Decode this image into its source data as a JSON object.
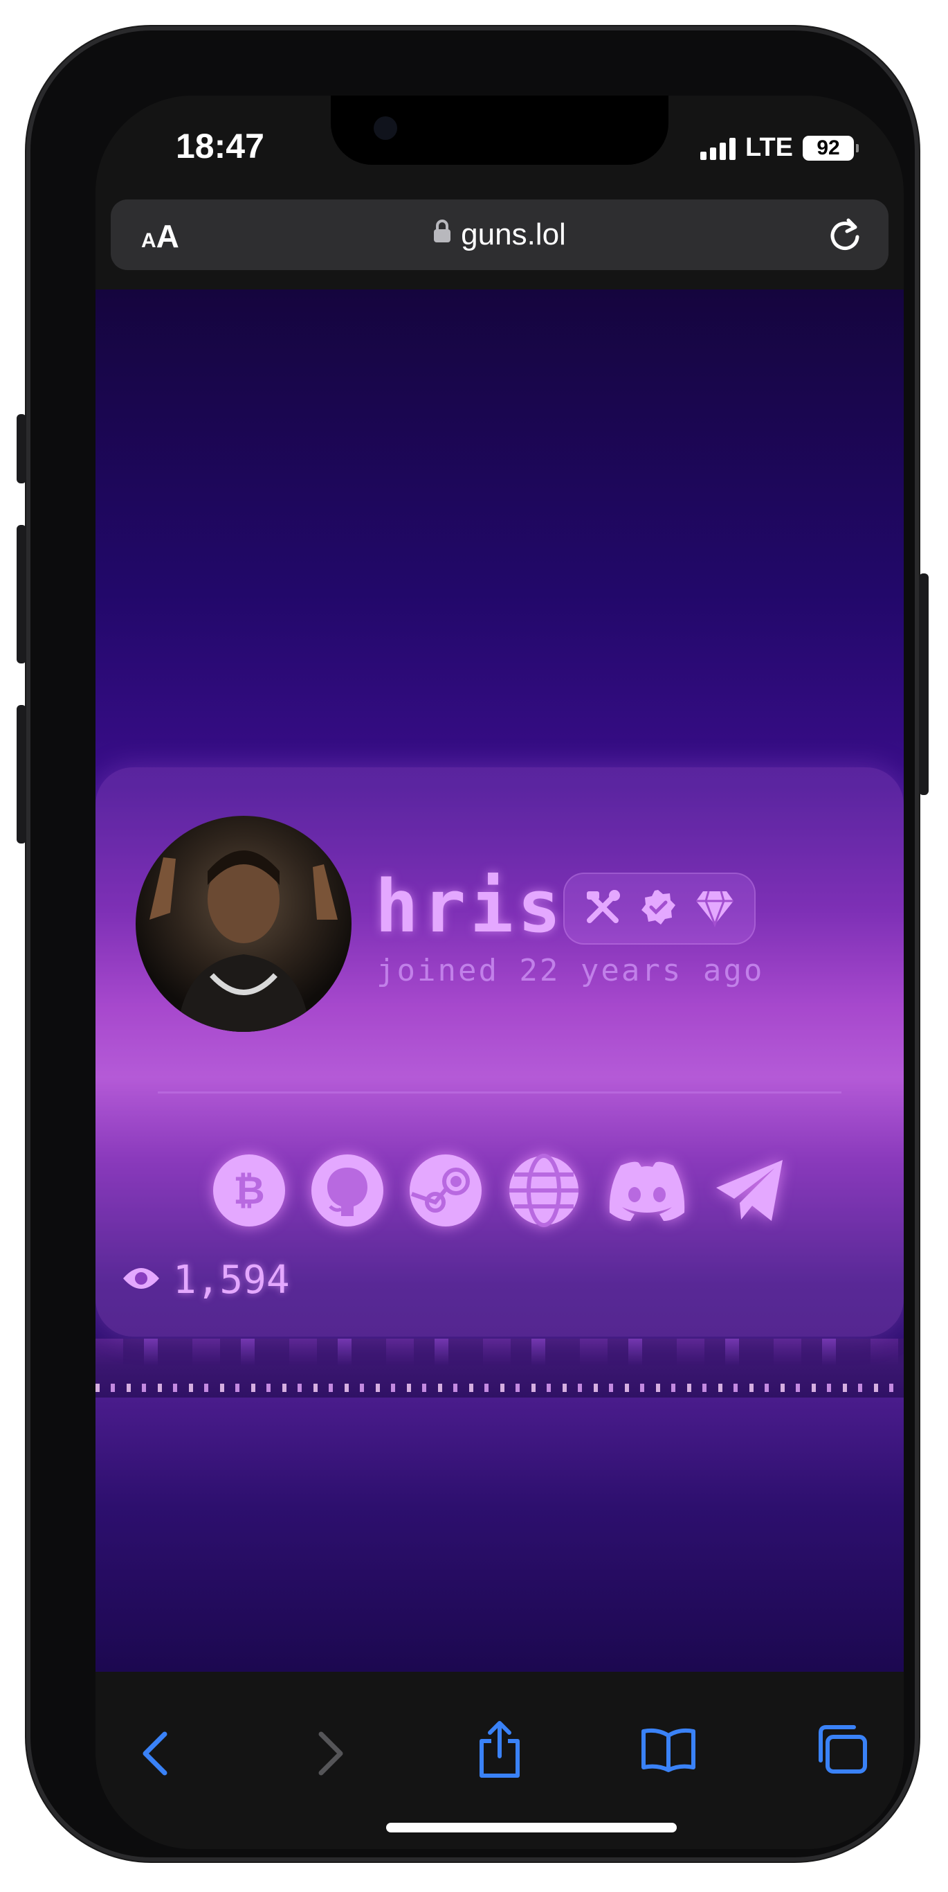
{
  "status_bar": {
    "time": "18:47",
    "network": "LTE",
    "battery": "92"
  },
  "browser": {
    "text_size_small": "A",
    "text_size_big": "A",
    "url": "guns.lol"
  },
  "profile": {
    "username": "hris",
    "joined": "joined 22 years ago",
    "badges": [
      "hammer-wrench-icon",
      "verified-icon",
      "diamond-icon"
    ],
    "socials": [
      "bitcoin-icon",
      "github-icon",
      "steam-icon",
      "globe-icon",
      "discord-icon",
      "telegram-icon"
    ],
    "views": "1,594"
  },
  "colors": {
    "accent": "#e4a8ff",
    "ios_blue": "#3a82f7"
  }
}
